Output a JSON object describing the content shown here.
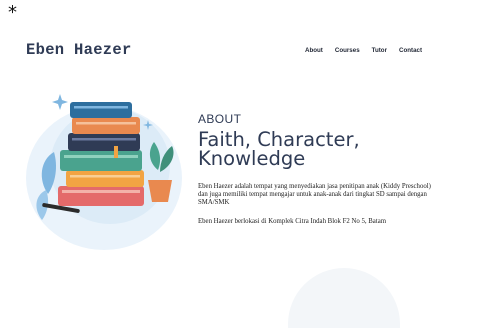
{
  "corner_mark": "*",
  "brand": {
    "name": "Eben Haezer"
  },
  "nav": {
    "items": [
      "About",
      "Courses",
      "Tutor",
      "Contact"
    ]
  },
  "hero_image": {
    "icon": "stack-of-books-illustration"
  },
  "about": {
    "label": "ABOUT",
    "headline": "Faith, Character, Knowledge",
    "paragraph1": "Eben Haezer adalah tempat yang menyediakan jasa penitipan anak (Kiddy Preschool) dan juga memiliki tempat mengajar untuk anak-anak dari tingkat SD sampai dengan SMA/SMK",
    "paragraph2": "Eben Haezer berlokasi di Komplek Citra Indah Blok F2 No 5, Batam"
  },
  "colors": {
    "brand": "#2f3b55",
    "blob": "#eaf3fb",
    "accent_blue": "#7fb6e0"
  }
}
